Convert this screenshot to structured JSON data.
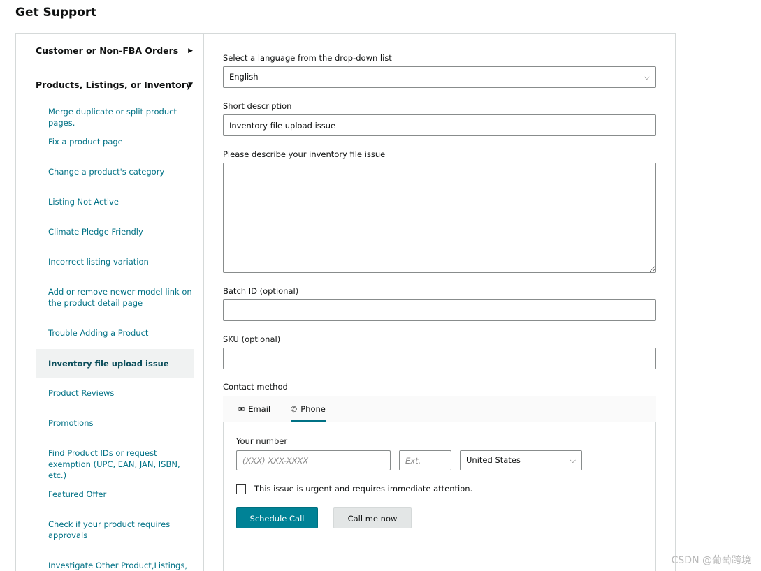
{
  "page": {
    "title": "Get Support"
  },
  "sidebar": {
    "categories": [
      {
        "label": "Customer or Non-FBA Orders",
        "caret": "▶"
      },
      {
        "label": "Products, Listings, or Inventory",
        "caret": "▼"
      }
    ],
    "items": [
      {
        "label": "Merge duplicate or split product pages."
      },
      {
        "label": "Fix a product page"
      },
      {
        "label": "Change a product's category"
      },
      {
        "label": "Listing Not Active"
      },
      {
        "label": "Climate Pledge Friendly"
      },
      {
        "label": "Incorrect listing variation"
      },
      {
        "label": "Add or remove newer model link on the product detail page"
      },
      {
        "label": "Trouble Adding a Product"
      },
      {
        "label": "Inventory file upload issue"
      },
      {
        "label": "Product Reviews"
      },
      {
        "label": "Promotions"
      },
      {
        "label": "Find Product IDs or request exemption (UPC, EAN, JAN, ISBN, etc.)"
      },
      {
        "label": "Featured Offer"
      },
      {
        "label": "Check if your product requires approvals"
      },
      {
        "label": "Investigate Other Product,Listings, or"
      }
    ]
  },
  "form": {
    "language_label": "Select a language from the drop-down list",
    "language_value": "English",
    "short_desc_label": "Short description",
    "short_desc_value": "Inventory file upload issue",
    "describe_label": "Please describe your inventory file issue",
    "describe_value": "",
    "batch_label": "Batch ID (optional)",
    "batch_value": "",
    "sku_label": "SKU (optional)",
    "sku_value": "",
    "contact_label": "Contact method"
  },
  "contact": {
    "tabs": [
      {
        "label": "Email",
        "icon": "envelope-icon"
      },
      {
        "label": "Phone",
        "icon": "phone-icon"
      }
    ],
    "your_number_label": "Your number",
    "phone_placeholder": "(XXX) XXX-XXXX",
    "ext_placeholder": "Ext.",
    "country_value": "United States",
    "urgent_label": "This issue is urgent and requires immediate attention.",
    "schedule_label": "Schedule Call",
    "call_now_label": "Call me now"
  },
  "watermark": "CSDN @葡萄跨境",
  "colors": {
    "accent": "#008296",
    "link": "#007185"
  }
}
